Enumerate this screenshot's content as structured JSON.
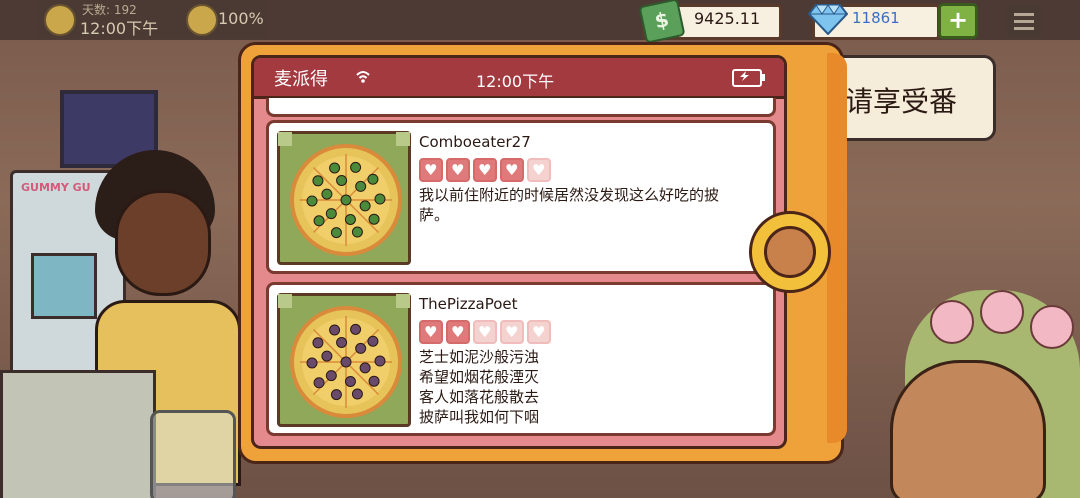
{
  "hud": {
    "day_label": "天数: 192",
    "clock": "12:00下午",
    "rating": "100%",
    "cash": "9425.11",
    "gems": "11861",
    "plus_label": "+"
  },
  "background": {
    "banner_text": "请享受番",
    "arcade_sign": "GUMMY GU"
  },
  "phone": {
    "app_name": "麦派得",
    "time": "12:00下午",
    "reviews": [
      {
        "username": "Comboeater27",
        "hearts_filled": 4,
        "hearts_total": 5,
        "text": "我以前住附近的时候居然没发现这么好吃的披\n萨。",
        "pizza_topping_color": "#4a8a3a"
      },
      {
        "username": "ThePizzaPoet",
        "hearts_filled": 2,
        "hearts_total": 5,
        "text": "芝士如泥沙般污浊\n希望如烟花般湮灭\n客人如落花般散去\n披萨叫我如何下咽",
        "pizza_topping_color": "#6a4a6a"
      }
    ]
  },
  "colors": {
    "status_bar": "#a33a40",
    "phone_body": "#f0a23a",
    "heart_on": "#e07a7a",
    "heart_off": "#f4d2d0"
  }
}
